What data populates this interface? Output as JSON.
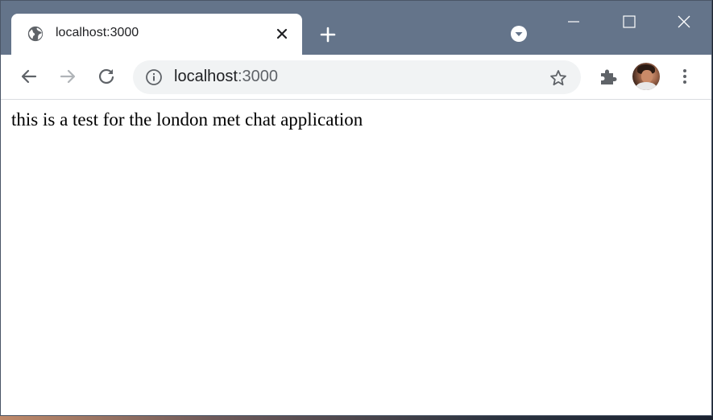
{
  "browser": {
    "tab": {
      "title": "localhost:3000",
      "icon": "globe-icon"
    },
    "omnibox": {
      "url_host": "localhost",
      "url_port": ":3000"
    },
    "icons": {
      "new_tab": "plus-icon",
      "tab_search": "chevron-down-circle-icon",
      "back": "arrow-left-icon",
      "forward": "arrow-right-icon",
      "reload": "reload-icon",
      "site_info": "info-icon",
      "bookmark": "star-icon",
      "extensions": "puzzle-icon",
      "menu": "kebab-menu-icon"
    },
    "colors": {
      "frame": "#64748a",
      "omnibox": "#f1f3f4"
    }
  },
  "page": {
    "text": "this is a test for the london met chat application"
  }
}
